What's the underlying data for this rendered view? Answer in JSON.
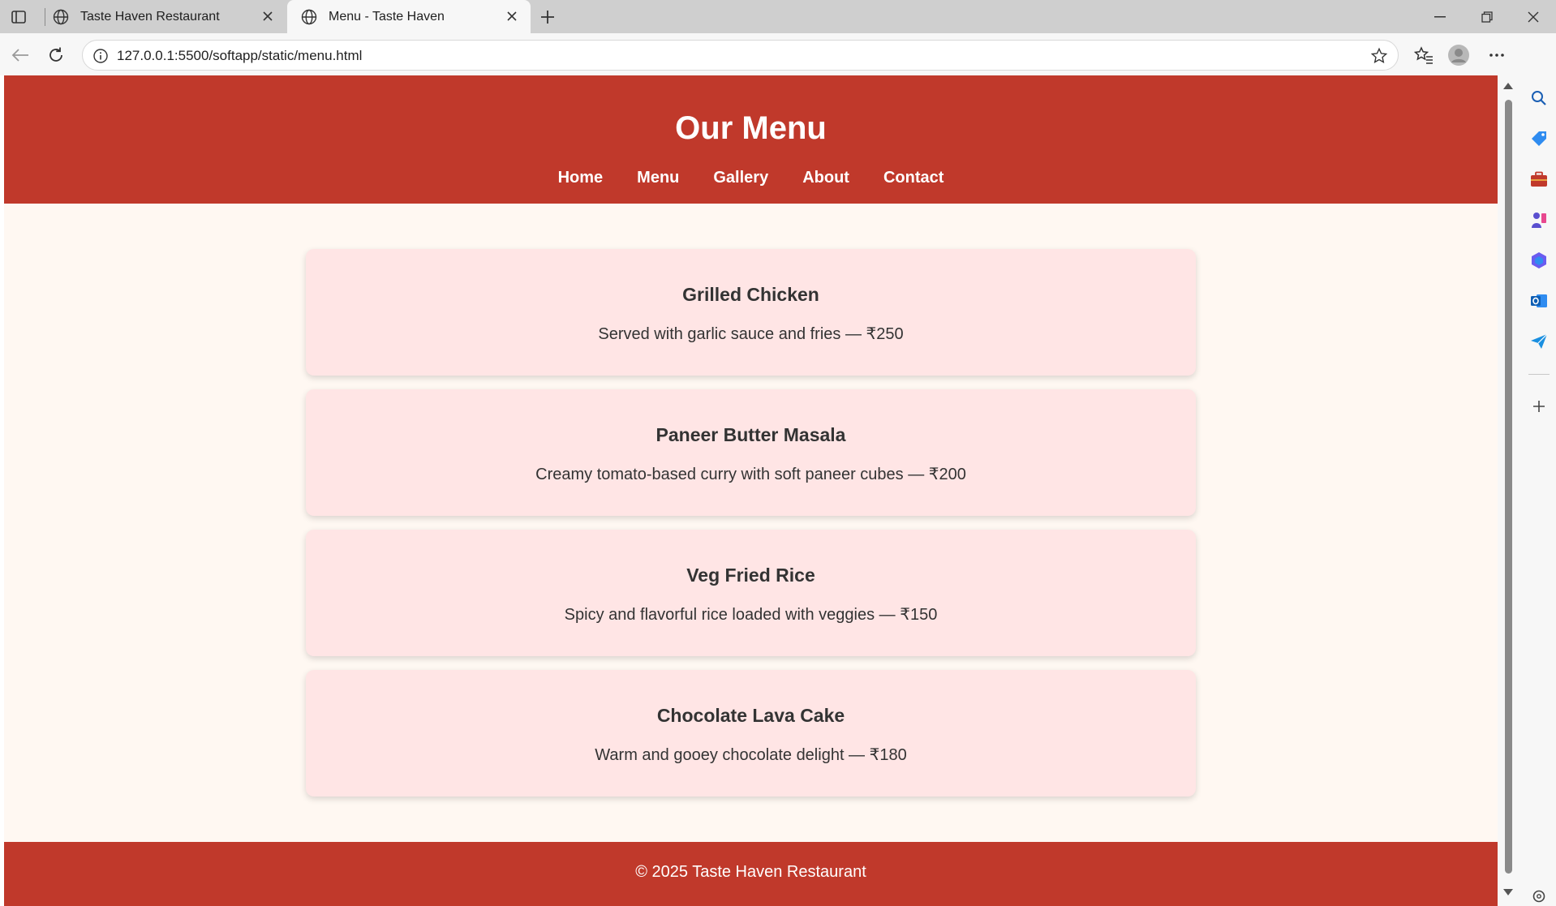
{
  "browser": {
    "tabs": [
      {
        "title": "Taste Haven Restaurant",
        "active": false
      },
      {
        "title": "Menu - Taste Haven",
        "active": true
      }
    ],
    "url": "127.0.0.1:5500/softapp/static/menu.html",
    "icons": [
      "sidebar-toggle-icon",
      "globe-icon",
      "close-icon",
      "new-tab-icon",
      "minimize-icon",
      "restore-icon",
      "window-close-icon",
      "back-icon",
      "refresh-icon",
      "info-icon",
      "favorite-star-icon",
      "favorites-icon",
      "profile-icon",
      "more-icon",
      "copilot-icon"
    ]
  },
  "side_panel": {
    "icons": [
      "search-icon",
      "shopping-tag-icon",
      "briefcase-icon",
      "games-icon",
      "office-icon",
      "outlook-icon",
      "send-icon",
      "add-icon",
      "settings-icon"
    ]
  },
  "site": {
    "title": "Our Menu",
    "nav": [
      "Home",
      "Menu",
      "Gallery",
      "About",
      "Contact"
    ],
    "menu_items": [
      {
        "name": "Grilled Chicken",
        "description": "Served with garlic sauce and fries — ₹250"
      },
      {
        "name": "Paneer Butter Masala",
        "description": "Creamy tomato-based curry with soft paneer cubes — ₹200"
      },
      {
        "name": "Veg Fried Rice",
        "description": "Spicy and flavorful rice loaded with veggies — ₹150"
      },
      {
        "name": "Chocolate Lava Cake",
        "description": "Warm and gooey chocolate delight — ₹180"
      }
    ],
    "footer": "© 2025 Taste Haven Restaurant"
  },
  "colors": {
    "brand_red": "#c0392b",
    "page_bg": "#fff8f2",
    "card_bg": "#ffe5e5",
    "text": "#333333"
  }
}
